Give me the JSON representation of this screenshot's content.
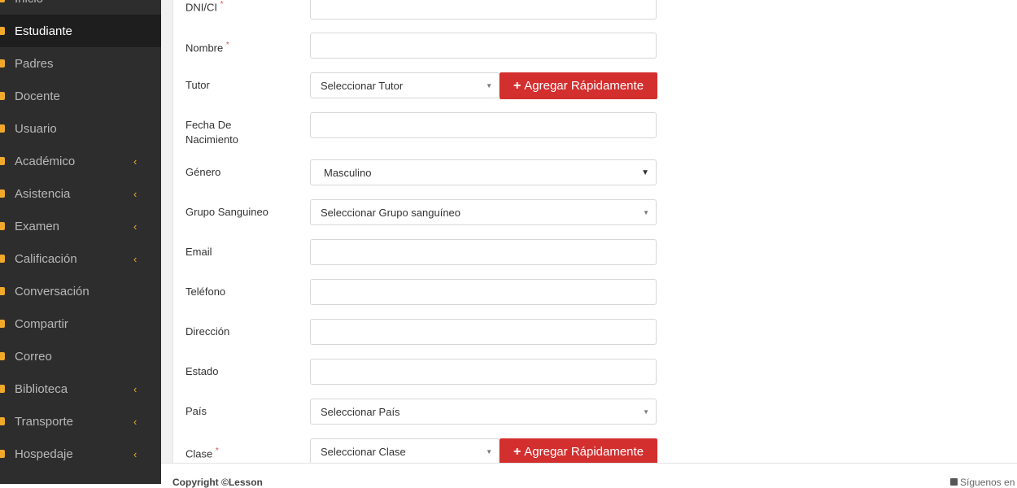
{
  "sidebar": {
    "items": [
      {
        "label": "Inicio",
        "active": false,
        "has_submenu": false,
        "icon": "home-icon"
      },
      {
        "label": "Estudiante",
        "active": true,
        "has_submenu": false,
        "icon": "student-icon"
      },
      {
        "label": "Padres",
        "active": false,
        "has_submenu": false,
        "icon": "parents-icon"
      },
      {
        "label": "Docente",
        "active": false,
        "has_submenu": false,
        "icon": "teacher-icon"
      },
      {
        "label": "Usuario",
        "active": false,
        "has_submenu": false,
        "icon": "user-icon"
      },
      {
        "label": "Académico",
        "active": false,
        "has_submenu": true,
        "icon": "academic-icon"
      },
      {
        "label": "Asistencia",
        "active": false,
        "has_submenu": true,
        "icon": "attendance-icon"
      },
      {
        "label": "Examen",
        "active": false,
        "has_submenu": true,
        "icon": "exam-icon"
      },
      {
        "label": "Calificación",
        "active": false,
        "has_submenu": true,
        "icon": "grade-icon"
      },
      {
        "label": "Conversación",
        "active": false,
        "has_submenu": false,
        "icon": "message-icon"
      },
      {
        "label": "Compartir",
        "active": false,
        "has_submenu": false,
        "icon": "share-icon"
      },
      {
        "label": "Correo",
        "active": false,
        "has_submenu": false,
        "icon": "mail-icon"
      },
      {
        "label": "Biblioteca",
        "active": false,
        "has_submenu": true,
        "icon": "library-icon"
      },
      {
        "label": "Transporte",
        "active": false,
        "has_submenu": true,
        "icon": "transport-icon"
      },
      {
        "label": "Hospedaje",
        "active": false,
        "has_submenu": true,
        "icon": "hostel-icon"
      }
    ],
    "chevron_glyph": "‹"
  },
  "form": {
    "dni": {
      "label": "DNI/CI",
      "value": ""
    },
    "nombre": {
      "label": "Nombre",
      "value": ""
    },
    "tutor": {
      "label": "Tutor",
      "selected": "Seleccionar Tutor"
    },
    "quick_add_label": "Agregar Rápidamente",
    "fecha": {
      "label_line1": "Fecha De",
      "label_line2": "Nacimiento",
      "value": ""
    },
    "genero": {
      "label": "Género",
      "selected": "Masculino"
    },
    "grupo": {
      "label": "Grupo Sanguineo",
      "selected": "Seleccionar Grupo sanguíneo"
    },
    "email": {
      "label": "Email",
      "value": ""
    },
    "telefono": {
      "label": "Teléfono",
      "value": ""
    },
    "direccion": {
      "label": "Dirección",
      "value": ""
    },
    "estado": {
      "label": "Estado",
      "value": ""
    },
    "pais": {
      "label": "País",
      "selected": "Seleccionar País"
    },
    "clase": {
      "label": "Clase",
      "selected": "Seleccionar Clase"
    },
    "required_mark": "*"
  },
  "footer": {
    "copyright": "Copyright ©Lesson",
    "follow": "Síguenos en"
  },
  "colors": {
    "sidebar_bg": "#2d2d2d",
    "accent_icon": "#f0a92a",
    "button_red": "#d32f2f",
    "required": "#d9534f"
  }
}
